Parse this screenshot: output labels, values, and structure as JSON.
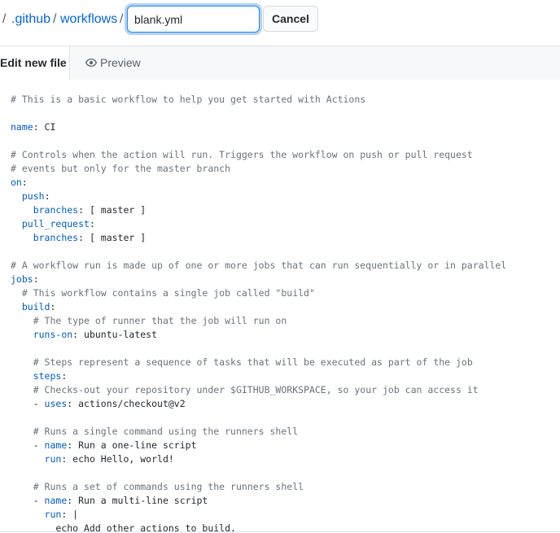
{
  "breadcrumb": {
    "lead_sep": "/",
    "github": ".github",
    "sep1": "/",
    "workflows": "workflows",
    "sep2": "/"
  },
  "filename": {
    "value": "blank.yml"
  },
  "cancel_label": "Cancel",
  "tabs": {
    "edit": "Edit new file",
    "preview": "Preview"
  },
  "code_lines": [
    [
      [
        "c",
        "# This is a basic workflow to help you get started with Actions"
      ]
    ],
    [],
    [
      [
        "k",
        "name"
      ],
      [
        "t",
        ": CI"
      ]
    ],
    [],
    [
      [
        "c",
        "# Controls when the action will run. Triggers the workflow on push or pull request"
      ]
    ],
    [
      [
        "c",
        "# events but only for the master branch"
      ]
    ],
    [
      [
        "k",
        "on"
      ],
      [
        "t",
        ":"
      ]
    ],
    [
      [
        "t",
        "  "
      ],
      [
        "k",
        "push"
      ],
      [
        "t",
        ":"
      ]
    ],
    [
      [
        "t",
        "    "
      ],
      [
        "k",
        "branches"
      ],
      [
        "t",
        ": [ master ]"
      ]
    ],
    [
      [
        "t",
        "  "
      ],
      [
        "k",
        "pull_request"
      ],
      [
        "t",
        ":"
      ]
    ],
    [
      [
        "t",
        "    "
      ],
      [
        "k",
        "branches"
      ],
      [
        "t",
        ": [ master ]"
      ]
    ],
    [],
    [
      [
        "c",
        "# A workflow run is made up of one or more jobs that can run sequentially or in parallel"
      ]
    ],
    [
      [
        "k",
        "jobs"
      ],
      [
        "t",
        ":"
      ]
    ],
    [
      [
        "t",
        "  "
      ],
      [
        "c",
        "# This workflow contains a single job called \"build\""
      ]
    ],
    [
      [
        "t",
        "  "
      ],
      [
        "k",
        "build"
      ],
      [
        "t",
        ":"
      ]
    ],
    [
      [
        "t",
        "    "
      ],
      [
        "c",
        "# The type of runner that the job will run on"
      ]
    ],
    [
      [
        "t",
        "    "
      ],
      [
        "k",
        "runs-on"
      ],
      [
        "t",
        ": ubuntu-latest"
      ]
    ],
    [],
    [
      [
        "t",
        "    "
      ],
      [
        "c",
        "# Steps represent a sequence of tasks that will be executed as part of the job"
      ]
    ],
    [
      [
        "t",
        "    "
      ],
      [
        "k",
        "steps"
      ],
      [
        "t",
        ":"
      ]
    ],
    [
      [
        "t",
        "    "
      ],
      [
        "c",
        "# Checks-out your repository under $GITHUB_WORKSPACE, so your job can access it"
      ]
    ],
    [
      [
        "t",
        "    - "
      ],
      [
        "k",
        "uses"
      ],
      [
        "t",
        ": actions/checkout@v2"
      ]
    ],
    [],
    [
      [
        "t",
        "    "
      ],
      [
        "c",
        "# Runs a single command using the runners shell"
      ]
    ],
    [
      [
        "t",
        "    - "
      ],
      [
        "k",
        "name"
      ],
      [
        "t",
        ": Run a one-line script"
      ]
    ],
    [
      [
        "t",
        "      "
      ],
      [
        "k",
        "run"
      ],
      [
        "t",
        ": echo Hello, world!"
      ]
    ],
    [],
    [
      [
        "t",
        "    "
      ],
      [
        "c",
        "# Runs a set of commands using the runners shell"
      ]
    ],
    [
      [
        "t",
        "    - "
      ],
      [
        "k",
        "name"
      ],
      [
        "t",
        ": Run a multi-line script"
      ]
    ],
    [
      [
        "t",
        "      "
      ],
      [
        "k",
        "run"
      ],
      [
        "t",
        ": |"
      ]
    ],
    [
      [
        "t",
        "        echo Add other actions to build,"
      ]
    ]
  ]
}
